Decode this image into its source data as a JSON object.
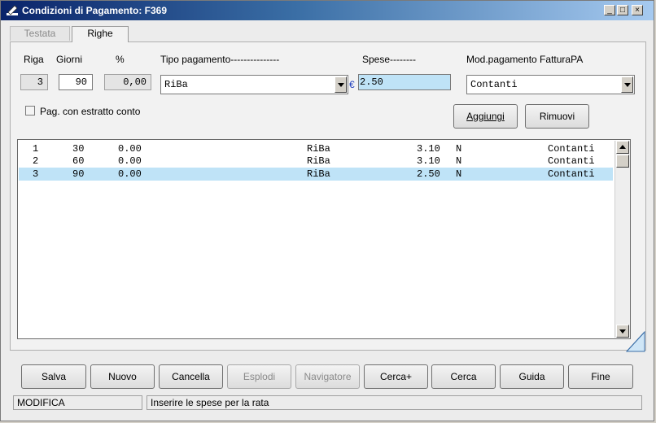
{
  "window": {
    "title": "Condizioni di Pagamento: F369",
    "controls": {
      "minimize": "_",
      "maximize": "□",
      "close": "×"
    }
  },
  "tabs": [
    {
      "label": "Testata",
      "active": false
    },
    {
      "label": "Righe",
      "active": true
    }
  ],
  "form": {
    "riga_label": "Riga",
    "giorni_label": "Giorni",
    "perc_label": "%",
    "tipo_label": "Tipo pagamento---------------",
    "spese_label": "Spese--------",
    "modpag_label": "Mod.pagamento FatturaPA",
    "riga_value": "3",
    "giorni_value": "90",
    "perc_value": "0,00",
    "tipo_value": "RiBa",
    "currency_symbol": "€",
    "spese_value": "2.50",
    "modpag_value": "Contanti",
    "estratto_label": "Pag. con estratto conto",
    "estratto_checked": false,
    "aggiungi_label": "Aggiungi",
    "rimuovi_label": "Rimuovi"
  },
  "list": {
    "rows": [
      {
        "riga": "1",
        "giorni": "30",
        "perc": "0.00",
        "tipo": "RiBa",
        "spese": "3.10",
        "flag": "N",
        "modpag": "Contanti",
        "selected": false
      },
      {
        "riga": "2",
        "giorni": "60",
        "perc": "0.00",
        "tipo": "RiBa",
        "spese": "3.10",
        "flag": "N",
        "modpag": "Contanti",
        "selected": false
      },
      {
        "riga": "3",
        "giorni": "90",
        "perc": "0.00",
        "tipo": "RiBa",
        "spese": "2.50",
        "flag": "N",
        "modpag": "Contanti",
        "selected": true
      }
    ]
  },
  "buttons": [
    {
      "name": "salva-button",
      "label": "Salva",
      "enabled": true
    },
    {
      "name": "nuovo-button",
      "label": "Nuovo",
      "enabled": true
    },
    {
      "name": "cancella-button",
      "label": "Cancella",
      "enabled": true
    },
    {
      "name": "esplodi-button",
      "label": "Esplodi",
      "enabled": false
    },
    {
      "name": "navigatore-button",
      "label": "Navigatore",
      "enabled": false
    },
    {
      "name": "cerca-plus-button",
      "label": "Cerca+",
      "enabled": true
    },
    {
      "name": "cerca-button",
      "label": "Cerca",
      "enabled": true
    },
    {
      "name": "guida-button",
      "label": "Guida",
      "enabled": true
    },
    {
      "name": "fine-button",
      "label": "Fine",
      "enabled": true
    }
  ],
  "status": {
    "mode": "MODIFICA",
    "message": "Inserire le spese per la rata"
  },
  "colors": {
    "selection": "#bfe3f7",
    "titlebar_start": "#0a246a",
    "titlebar_end": "#a6caf0",
    "input_highlight": "#bfe3f7"
  }
}
